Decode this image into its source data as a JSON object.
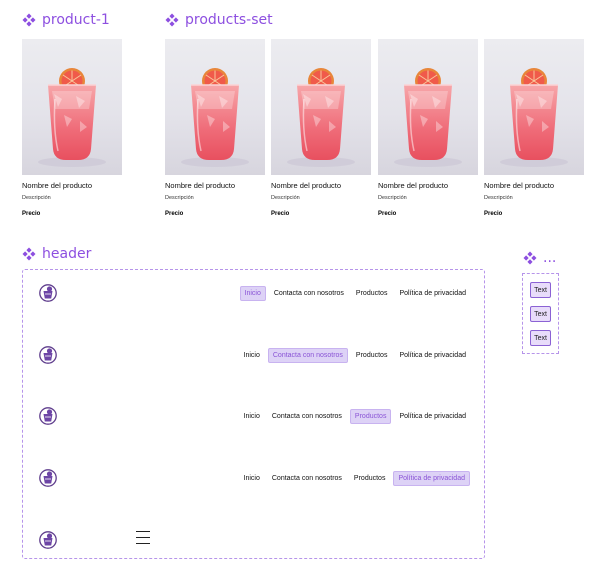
{
  "sections": {
    "product": "product-1",
    "products_set": "products-set",
    "header": "header",
    "buttons": "..."
  },
  "product": {
    "name": "Nombre del producto",
    "description": "Descripción",
    "price": "Precio"
  },
  "products_set": [
    {
      "name": "Nombre del producto",
      "description": "Descripción",
      "price": "Precio"
    },
    {
      "name": "Nombre del producto",
      "description": "Descripción",
      "price": "Precio"
    },
    {
      "name": "Nombre del producto",
      "description": "Descripción",
      "price": "Precio"
    },
    {
      "name": "Nombre del producto",
      "description": "Descripción",
      "price": "Precio"
    }
  ],
  "nav": {
    "inicio": "Inicio",
    "contacto": "Contacta con nosotros",
    "productos": "Productos",
    "privacidad": "Política de privacidad"
  },
  "buttons": [
    "Text",
    "Text",
    "Text"
  ],
  "colors": {
    "accent": "#8d4fe0",
    "active_bg": "#ddd2f6",
    "frame_border": "#b694ea"
  },
  "icons": {
    "component": "component-icon",
    "logo": "drink-logo-icon",
    "menu": "hamburger-menu-icon"
  }
}
